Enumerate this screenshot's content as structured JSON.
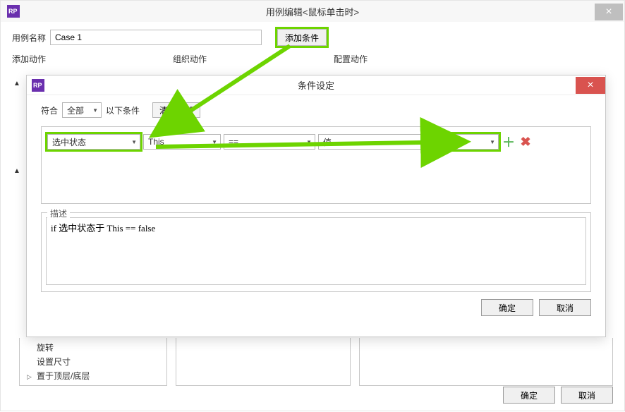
{
  "main_window": {
    "title": "用例编辑<鼠标单击时>",
    "close_tooltip": "×",
    "case_label": "用例名称",
    "case_name_value": "Case 1",
    "add_condition_label": "添加条件",
    "tabs": {
      "t1": "添加动作",
      "t2": "组织动作",
      "t3": "配置动作"
    },
    "tree": {
      "rotate": "旋转",
      "set_size": "设置尺寸",
      "z_order": "置于顶层/底层"
    },
    "ok_label": "确定",
    "cancel_label": "取消"
  },
  "cond_dialog": {
    "title": "条件设定",
    "close_tooltip": "×",
    "match_prefix": "符合",
    "match_mode": "全部",
    "match_suffix": "以下条件",
    "clear_all": "清除全部",
    "row": {
      "field": "选中状态",
      "target": "This",
      "op": "==",
      "value_type": "值",
      "value": "false"
    },
    "desc_legend": "描述",
    "desc_text": "if 选中状态于 This == false",
    "ok_label": "确定",
    "cancel_label": "取消"
  }
}
